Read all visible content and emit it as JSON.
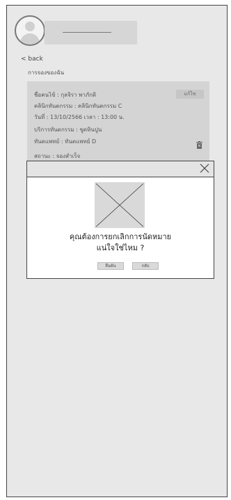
{
  "header": {
    "back_label": "< back",
    "page_title": "การจองของฉัน"
  },
  "booking": {
    "edit_label": "แก้ไข",
    "lines": [
      "ชื่อคนไข้ :   กุลจิรา  พาภักดิ",
      "คลินิกทันตกรรม :   คลินิกทันตกรรม C",
      "วันที่ : 13/10/2566    เวลา : 13:00 น.",
      "บริการทันตกรรม : ขูดหินปูน",
      "ทันตแพทย์ :  ทันตแพทย์ D",
      "สถานะ :  จองสำเร็จ"
    ]
  },
  "dialog": {
    "message_line1": "คุณต้องการยกเลิกการนัดหมาย",
    "message_line2": "แน่ใจใช่ไหม ?",
    "confirm_label": "ยืนยัน",
    "back_label": "กลับ"
  },
  "colors": {
    "background": "#e8e8e8",
    "card": "#d4d4d4",
    "modal": "#ffffff",
    "border": "#444444"
  },
  "icons": [
    "avatar-icon",
    "trash-icon",
    "close-icon",
    "image-placeholder-icon"
  ]
}
